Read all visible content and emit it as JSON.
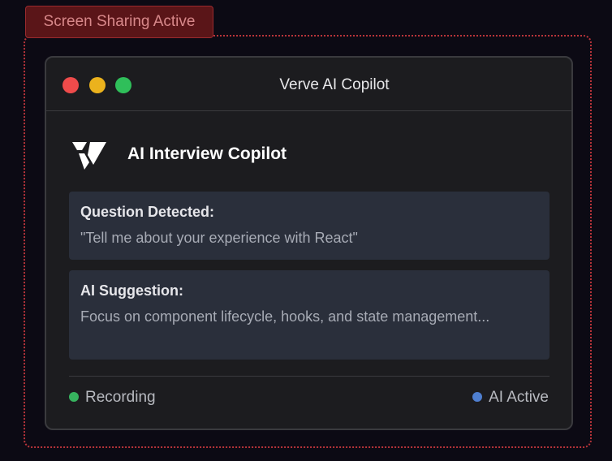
{
  "share_badge": {
    "label": "Screen Sharing Active",
    "border_color": "#b8343a"
  },
  "window": {
    "title": "Verve AI Copilot",
    "controls": {
      "close_color": "#ee4b4b",
      "minimize_color": "#ebb21d",
      "maximize_color": "#2fbf5a"
    }
  },
  "header": {
    "logo_icon": "verve-v-logo-icon",
    "title": "AI Interview Copilot"
  },
  "question_card": {
    "label": "Question Detected:",
    "text": "\"Tell me about your experience with React\""
  },
  "suggestion_card": {
    "label": "AI Suggestion:",
    "text": "Focus on component lifecycle, hooks, and state management..."
  },
  "status_bar": {
    "recording": {
      "label": "Recording",
      "dot_color": "#37b35f"
    },
    "ai_status": {
      "label": "AI Active",
      "dot_color": "#4f7fd0"
    }
  }
}
